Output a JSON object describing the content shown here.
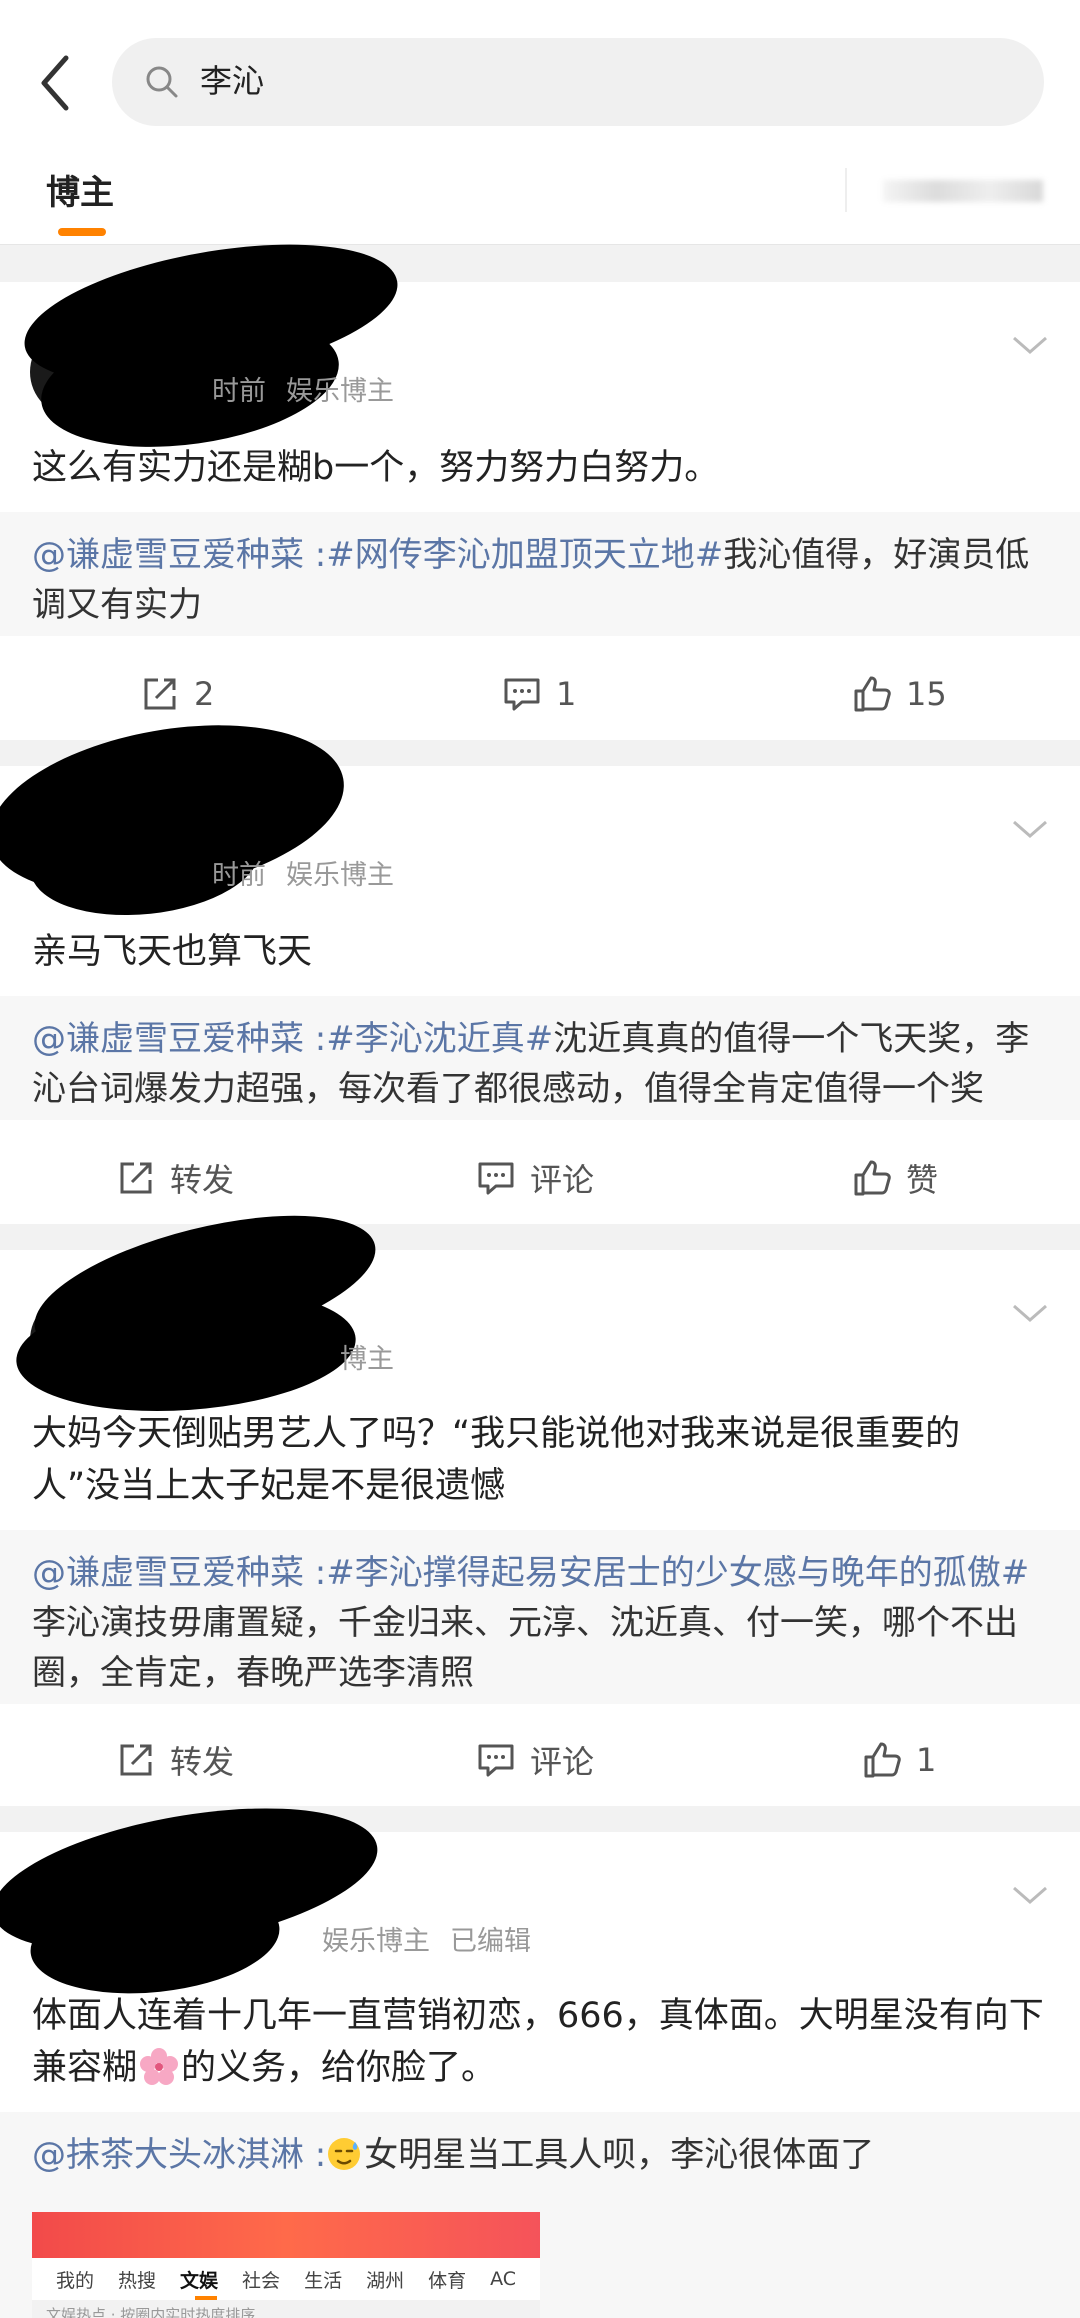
{
  "search": {
    "query": "李沁"
  },
  "tabs": {
    "active": "博主"
  },
  "posts": [
    {
      "meta": [
        "时前",
        "娱乐博主"
      ],
      "text": "这么有实力还是糊b一个，努力努力白努力。",
      "repost": {
        "user": "@谦虚雪豆爱种菜",
        "sep": " :",
        "topic": "#网传李沁加盟顶天立地#",
        "text": "我沁值得，好演员低调又有实力"
      },
      "actions": {
        "repost": "2",
        "comment": "1",
        "like": "15"
      }
    },
    {
      "meta": [
        "时前",
        "娱乐博主"
      ],
      "text": "亲马飞天也算飞天",
      "repost": {
        "user": "@谦虚雪豆爱种菜",
        "sep": " :",
        "topic": "#李沁沈近真#",
        "text": "沈近真真的值得一个飞天奖，李沁台词爆发力超强，每次看了都很感动，值得全肯定值得一个奖"
      },
      "actions": {
        "repost": "转发",
        "comment": "评论",
        "like": "赞"
      }
    },
    {
      "meta": [
        "博主"
      ],
      "text": "大妈今天倒贴男艺人了吗？“我只能说他对我来说是很重要的人”没当上太子妃是不是很遗憾",
      "repost": {
        "user": "@谦虚雪豆爱种菜",
        "sep": " :",
        "topic": "#李沁撑得起易安居士的少女感与晚年的孤傲#",
        "text": "李沁演技毋庸置疑，千金归来、元淳、沈近真、付一笑，哪个不出圈，全肯定，春晚严选李清照"
      },
      "actions": {
        "repost": "转发",
        "comment": "评论",
        "like": "1"
      }
    },
    {
      "meta": [
        "娱乐博主",
        "已编辑"
      ],
      "text_before": "体面人连着十几年一直营销初恋，666，真体面。大明星没有向下兼容糊",
      "text_after": "的义务，给你脸了。",
      "repost": {
        "user": "@抹茶大头冰淇淋",
        "sep": " :",
        "text": "女明星当工具人呗，李沁很体面了"
      }
    }
  ],
  "thumbnail": {
    "nav": [
      "我的",
      "热搜",
      "文娱",
      "社会",
      "生活",
      "湖州",
      "体育",
      "AC"
    ],
    "active_index": 2,
    "sub": "文娱热点 · 按圈内实时热度排序"
  }
}
